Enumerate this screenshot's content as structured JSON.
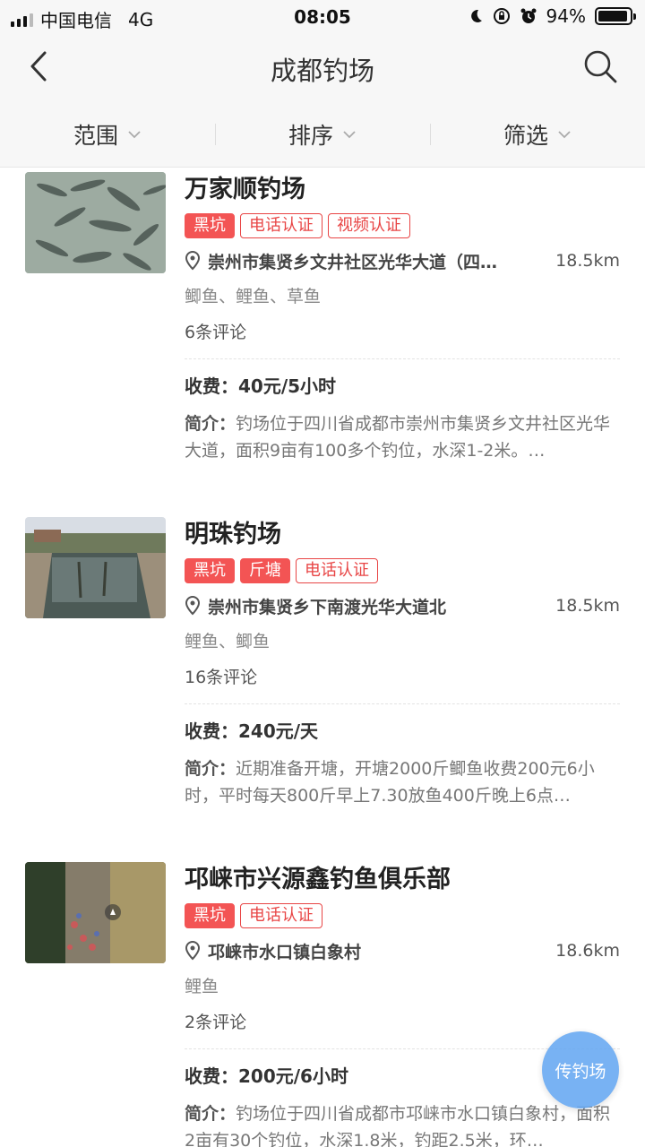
{
  "status_bar": {
    "carrier": "中国电信",
    "network": "4G",
    "time": "08:05",
    "battery": "94%",
    "battery_level": 0.94
  },
  "nav": {
    "title": "成都钓场",
    "back_icon": "chevron-left-icon",
    "search_icon": "search-icon"
  },
  "filters": [
    {
      "label": "范围"
    },
    {
      "label": "排序"
    },
    {
      "label": "筛选"
    }
  ],
  "spots": [
    {
      "name": "万家顺钓场",
      "tags": [
        {
          "label": "黑坑",
          "solid": true
        },
        {
          "label": "电话认证",
          "solid": false
        },
        {
          "label": "视频认证",
          "solid": false
        }
      ],
      "address": "崇州市集贤乡文井社区光华大道（四…",
      "distance": "18.5km",
      "fish": "鲫鱼、鲤鱼、草鱼",
      "reviews": "6条评论",
      "fee": "收费：40元/5小时",
      "intro_label": "简介：",
      "intro": "钓场位于四川省成都市崇州市集贤乡文井社区光华大道，面积9亩有100多个钓位，水深1-2米。…"
    },
    {
      "name": "明珠钓场",
      "tags": [
        {
          "label": "黑坑",
          "solid": true
        },
        {
          "label": "斤塘",
          "solid": true
        },
        {
          "label": "电话认证",
          "solid": false
        }
      ],
      "address": "崇州市集贤乡下南渡光华大道北",
      "distance": "18.5km",
      "fish": "鲤鱼、鲫鱼",
      "reviews": "16条评论",
      "fee": "收费：240元/天",
      "intro_label": "简介：",
      "intro": "近期准备开塘，开塘2000斤鲫鱼收费200元6小时，平时每天800斤早上7.30放鱼400斤晚上6点…"
    },
    {
      "name": "邛崃市兴源鑫钓鱼俱乐部",
      "tags": [
        {
          "label": "黑坑",
          "solid": true
        },
        {
          "label": "电话认证",
          "solid": false
        }
      ],
      "address": "邛崃市水口镇白象村",
      "distance": "18.6km",
      "fish": "鲤鱼",
      "reviews": "2条评论",
      "fee": "收费：200元/6小时",
      "intro_label": "简介：",
      "intro": "钓场位于四川省成都市邛崃市水口镇白象村，面积2亩有30个钓位，水深1.8米，钓距2.5米，环…"
    }
  ],
  "fab": {
    "label": "传钓场"
  },
  "colors": {
    "accent_red": "#f35454",
    "fab_blue": "#6aaaf2",
    "bar_bg": "#f7f7f7"
  }
}
